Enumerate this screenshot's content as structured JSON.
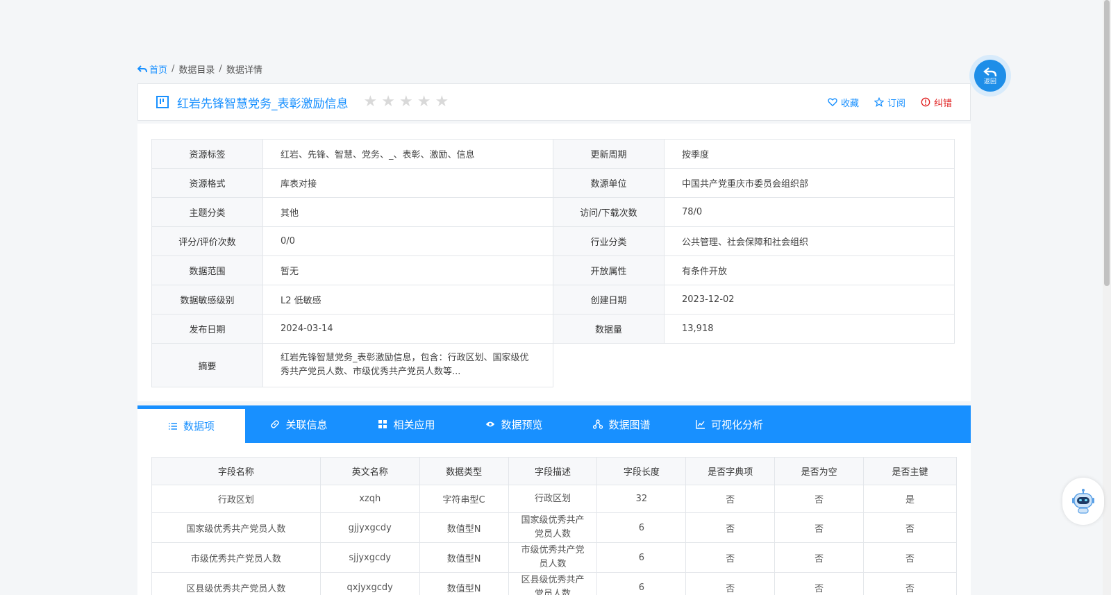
{
  "breadcrumb": {
    "home": "首页",
    "sep1": "/",
    "catalog": "数据目录",
    "sep2": "/",
    "current": "数据详情"
  },
  "header": {
    "title": "红岩先锋智慧党务_表彰激励信息",
    "rating": 0,
    "actions": {
      "favorite": "收藏",
      "subscribe": "订阅",
      "report": "纠错"
    }
  },
  "back_button": {
    "label": "返回"
  },
  "info": {
    "rows": [
      {
        "l1": "资源标签",
        "v1": "红岩、先锋、智慧、党务、_、表彰、激励、信息",
        "l2": "更新周期",
        "v2": "按季度"
      },
      {
        "l1": "资源格式",
        "v1": "库表对接",
        "l2": "数源单位",
        "v2": "中国共产党重庆市委员会组织部"
      },
      {
        "l1": "主题分类",
        "v1": "其他",
        "l2": "访问/下载次数",
        "v2": "78/0"
      },
      {
        "l1": "评分/评价次数",
        "v1": "0/0",
        "l2": "行业分类",
        "v2": "公共管理、社会保障和社会组织"
      },
      {
        "l1": "数据范围",
        "v1": "暂无",
        "l2": "开放属性",
        "v2": "有条件开放"
      },
      {
        "l1": "数据敏感级别",
        "v1": "L2 低敏感",
        "l2": "创建日期",
        "v2": "2023-12-02"
      },
      {
        "l1": "发布日期",
        "v1": "2024-03-14",
        "l2": "数据量",
        "v2": "13,918"
      }
    ],
    "summary_label": "摘要",
    "summary_value": "红岩先锋智慧党务_表彰激励信息，包含：行政区划、国家级优秀共产党员人数、市级优秀共产党员人数等..."
  },
  "tabs": [
    {
      "label": "数据项"
    },
    {
      "label": "关联信息"
    },
    {
      "label": "相关应用"
    },
    {
      "label": "数据预览"
    },
    {
      "label": "数据图谱"
    },
    {
      "label": "可视化分析"
    }
  ],
  "fields": {
    "headers": [
      "字段名称",
      "英文名称",
      "数据类型",
      "字段描述",
      "字段长度",
      "是否字典项",
      "是否为空",
      "是否主键"
    ],
    "rows": [
      [
        "行政区划",
        "xzqh",
        "字符串型C",
        "行政区划",
        "32",
        "否",
        "否",
        "是"
      ],
      [
        "国家级优秀共产党员人数",
        "gjjyxgcdy",
        "数值型N",
        "国家级优秀共产党员人数",
        "6",
        "否",
        "否",
        "否"
      ],
      [
        "市级优秀共产党员人数",
        "sjjyxgcdy",
        "数值型N",
        "市级优秀共产党员人数",
        "6",
        "否",
        "否",
        "否"
      ],
      [
        "区县级优秀共产党员人数",
        "qxjyxgcdy",
        "数值型N",
        "区县级优秀共产党员人数",
        "6",
        "否",
        "否",
        "否"
      ]
    ]
  },
  "colors": {
    "accent": "#1890ff",
    "error": "#e02020",
    "star": "#d9d9d9"
  }
}
